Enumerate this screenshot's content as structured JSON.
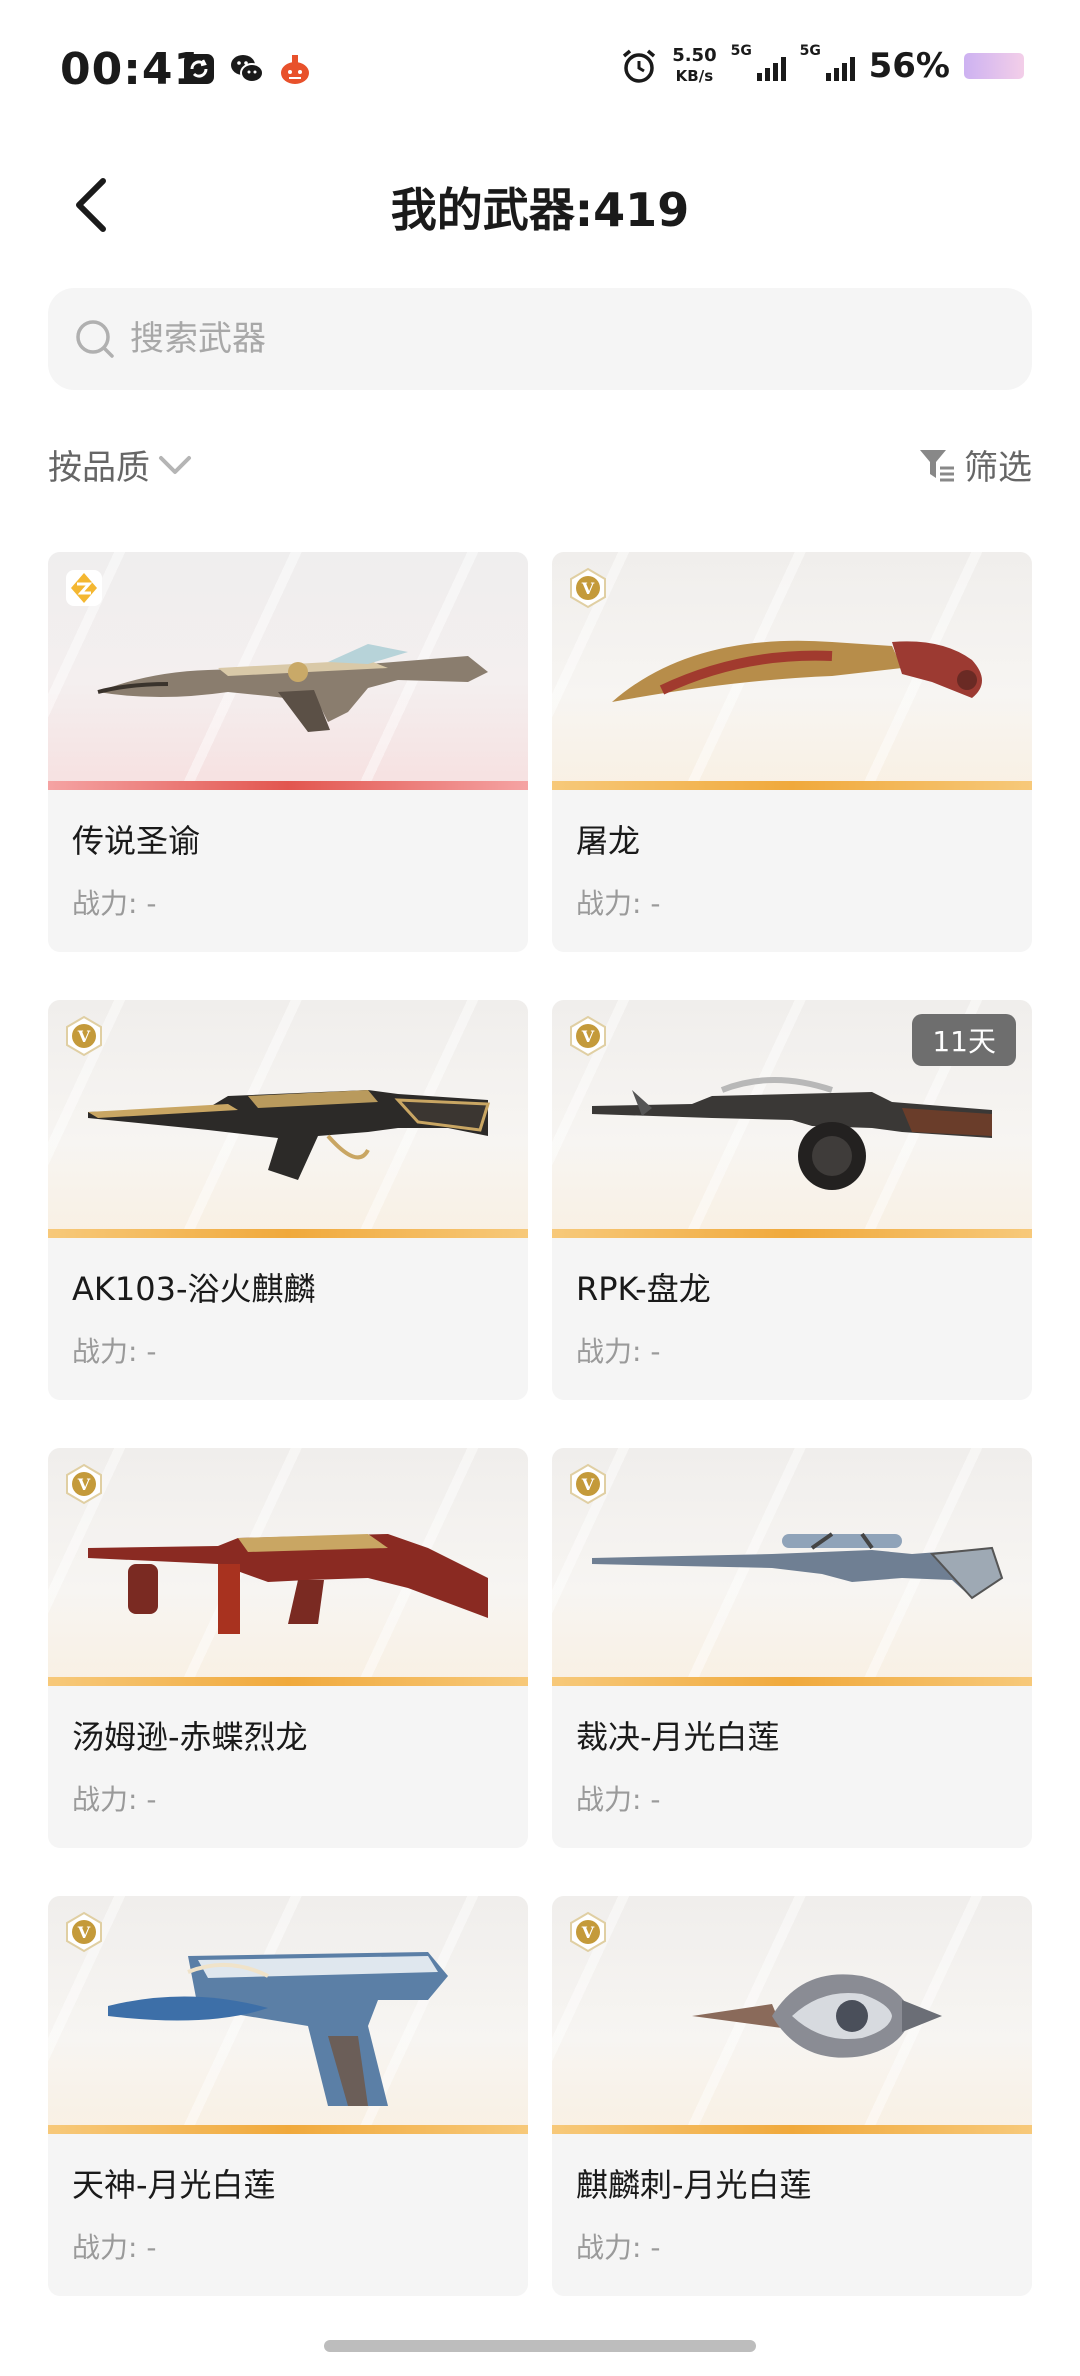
{
  "status_bar": {
    "time": "00:41",
    "net_speed_value": "5.50",
    "net_speed_unit": "KB/s",
    "signal1_tag": "5G",
    "signal2_tag": "5G",
    "battery_percent": "56%"
  },
  "header": {
    "title": "我的武器:419"
  },
  "search": {
    "placeholder": "搜索武器"
  },
  "toolbar": {
    "sort_label": "按品质",
    "filter_label": "筛选"
  },
  "weapons": [
    {
      "name": "传说圣谕",
      "power": "战力: -",
      "rank_icon": "legend-diamond-icon",
      "stripe_color": "#e2564f"
    },
    {
      "name": "屠龙",
      "power": "战力: -",
      "rank_icon": "v-rank-icon",
      "stripe_color": "#f0a93c"
    },
    {
      "name": "AK103-浴火麒麟",
      "power": "战力: -",
      "rank_icon": "v-rank-icon",
      "stripe_color": "#f0a93c"
    },
    {
      "name": "RPK-盘龙",
      "power": "战力: -",
      "rank_icon": "v-rank-icon",
      "stripe_color": "#f0a93c",
      "badge": "11天"
    },
    {
      "name": "汤姆逊-赤蝶烈龙",
      "power": "战力: -",
      "rank_icon": "v-rank-icon",
      "stripe_color": "#f0a93c"
    },
    {
      "name": "裁决-月光白莲",
      "power": "战力: -",
      "rank_icon": "v-rank-icon",
      "stripe_color": "#f0a93c"
    },
    {
      "name": "天神-月光白莲",
      "power": "战力: -",
      "rank_icon": "v-rank-icon",
      "stripe_color": "#f0a93c"
    },
    {
      "name": "麒麟刺-月光白莲",
      "power": "战力: -",
      "rank_icon": "v-rank-icon",
      "stripe_color": "#f0a93c"
    }
  ],
  "colors": {
    "legendary_stripe": "#e2564f",
    "rare_stripe": "#f0a93c",
    "badge_bg": "#6e6e6e"
  }
}
